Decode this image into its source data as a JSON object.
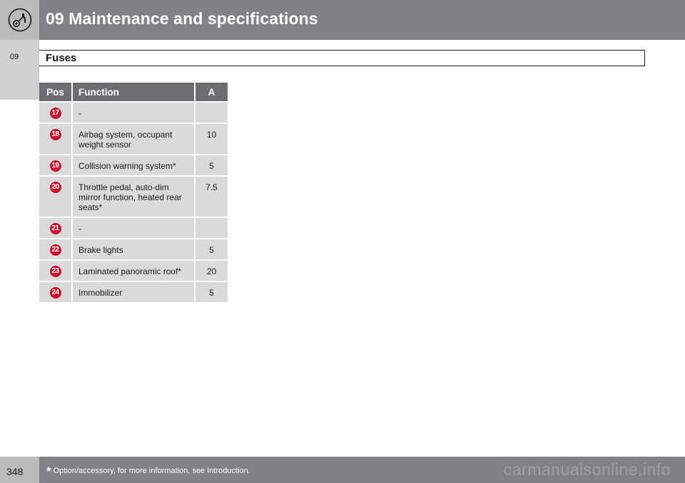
{
  "header": {
    "chapter_title": "09 Maintenance and specifications",
    "icon": "wrench-gear-icon"
  },
  "side_tab": {
    "label": "09"
  },
  "section": {
    "title": "Fuses"
  },
  "table": {
    "headers": {
      "pos": "Pos",
      "function": "Function",
      "amps": "A"
    },
    "rows": [
      {
        "pos": "17",
        "function": "-",
        "amps": ""
      },
      {
        "pos": "18",
        "function": "Airbag system, occupant weight sensor",
        "amps": "10"
      },
      {
        "pos": "19",
        "function": "Collision warning system*",
        "amps": "5"
      },
      {
        "pos": "20",
        "function": "Throttle pedal, auto-dim mirror function, heated rear seats*",
        "amps": "7.5"
      },
      {
        "pos": "21",
        "function": "-",
        "amps": ""
      },
      {
        "pos": "22",
        "function": "Brake lights",
        "amps": "5"
      },
      {
        "pos": "23",
        "function": "Laminated panoramic roof*",
        "amps": "20"
      },
      {
        "pos": "24",
        "function": "Immobilizer",
        "amps": "5"
      }
    ]
  },
  "footer": {
    "page_number": "348",
    "footnote_marker": "*",
    "footnote": "Option/accessory, for more information, see Introduction.",
    "watermark": "carmanualsonline.info"
  },
  "colors": {
    "header_gray": "#808285",
    "table_header": "#6d6e71",
    "table_cell": "#d9dadb",
    "badge_red": "#c8102e"
  }
}
